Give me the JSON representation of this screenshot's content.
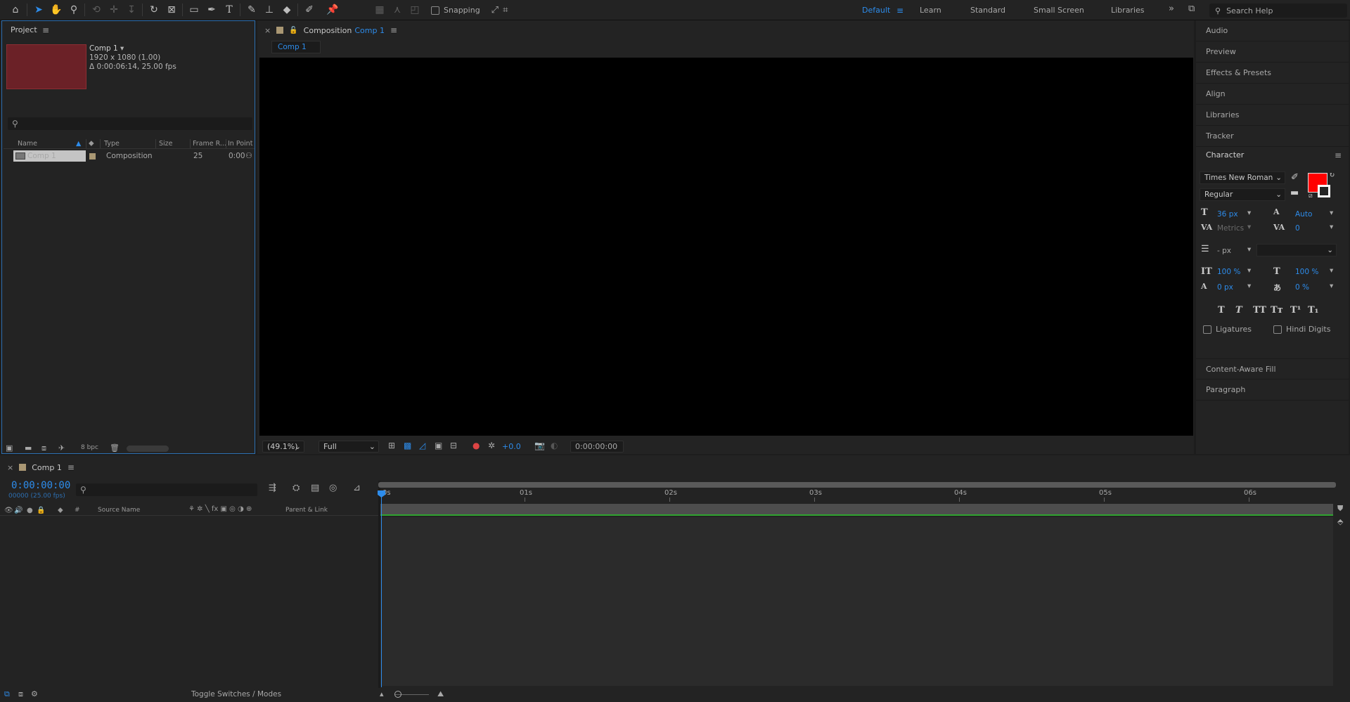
{
  "toolbar": {
    "snapping_label": "Snapping",
    "workspaces": [
      "Default",
      "Learn",
      "Standard",
      "Small Screen",
      "Libraries"
    ],
    "active_workspace": "Default",
    "search_placeholder": "Search Help"
  },
  "project": {
    "tab_label": "Project",
    "comp_name": "Comp 1",
    "comp_resolution": "1920 x 1080 (1.00)",
    "comp_duration": "Δ 0:00:06:14, 25.00 fps",
    "columns": [
      "Name",
      "Type",
      "Size",
      "Frame R...",
      "In Point"
    ],
    "rows": [
      {
        "name": "Comp 1",
        "type": "Composition",
        "size": "",
        "frame_rate": "25",
        "in_point": "0:00"
      }
    ],
    "bit_depth": "8 bpc"
  },
  "composition": {
    "tab_prefix": "Composition",
    "tab_name": "Comp 1",
    "subtab": "Comp 1",
    "zoom": "(49.1%)",
    "resolution": "Full",
    "exposure": "+0.0",
    "timecode": "0:00:00:00"
  },
  "right_panels": {
    "items": [
      "Audio",
      "Preview",
      "Effects & Presets",
      "Align",
      "Libraries",
      "Tracker"
    ],
    "character_title": "Character",
    "font_family": "Times New Roman",
    "font_style": "Regular",
    "font_size": "36 px",
    "leading": "Auto",
    "kerning": "Metrics",
    "tracking": "0",
    "stroke_width": "- px",
    "vertical_scale": "100 %",
    "horizontal_scale": "100 %",
    "baseline_shift": "0 px",
    "tsume": "0 %",
    "ligatures_label": "Ligatures",
    "hindi_digits_label": "Hindi Digits",
    "bottom_items": [
      "Content-Aware Fill",
      "Paragraph"
    ],
    "fill_color": "#ff0000",
    "stroke_color": "#ffffff"
  },
  "timeline": {
    "tab_label": "Comp 1",
    "timecode": "0:00:00:00",
    "frame_info": "00000 (25.00 fps)",
    "columns": [
      "#",
      "Source Name",
      "Parent & Link"
    ],
    "ticks": [
      "0s",
      "01s",
      "02s",
      "03s",
      "04s",
      "05s",
      "06s"
    ],
    "toggle_label": "Toggle Switches / Modes"
  },
  "colors": {
    "accent": "#2d8ceb",
    "label_sand": "#a99773",
    "work_area_green": "#2fa32f"
  }
}
